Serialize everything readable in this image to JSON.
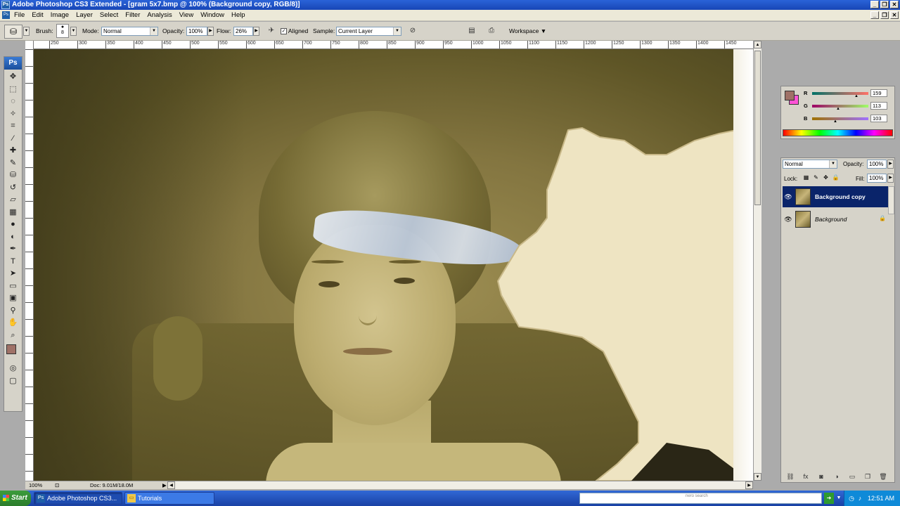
{
  "window": {
    "title": "Adobe Photoshop CS3 Extended - [gram 5x7.bmp @ 100% (Background copy, RGB/8)]"
  },
  "menu": {
    "items": [
      "File",
      "Edit",
      "Image",
      "Layer",
      "Select",
      "Filter",
      "Analysis",
      "View",
      "Window",
      "Help"
    ]
  },
  "options": {
    "brush_label": "Brush:",
    "brush_size": "8",
    "mode_label": "Mode:",
    "mode_value": "Normal",
    "opacity_label": "Opacity:",
    "opacity_value": "100%",
    "flow_label": "Flow:",
    "flow_value": "26%",
    "aligned_label": "Aligned",
    "sample_label": "Sample:",
    "sample_value": "Current Layer",
    "workspace_label": "Workspace ▼"
  },
  "toolbox": {
    "badge": "Ps",
    "tools": [
      "move-tool-icon",
      "marquee-tool-icon",
      "lasso-tool-icon",
      "magic-wand-icon",
      "crop-tool-icon",
      "eyedropper-icon",
      "healing-brush-icon",
      "brush-tool-icon",
      "clone-stamp-icon",
      "history-brush-icon",
      "eraser-icon",
      "gradient-tool-icon",
      "blur-tool-icon",
      "dodge-tool-icon",
      "pen-tool-icon",
      "type-tool-icon",
      "path-selection-icon",
      "shape-tool-icon",
      "notes-tool-icon",
      "eyedropper-2-icon",
      "hand-tool-icon",
      "zoom-tool-icon"
    ],
    "foreground_color": "#9f7167",
    "background_color": "#ff54d6"
  },
  "ruler": {
    "labels": [
      "250",
      "300",
      "350",
      "400",
      "450",
      "500",
      "550",
      "600",
      "650",
      "700",
      "750",
      "800",
      "850",
      "900",
      "950",
      "1000",
      "1050",
      "1100",
      "1150",
      "1200",
      "1250",
      "1300",
      "1350",
      "1400",
      "1450"
    ]
  },
  "status": {
    "zoom": "100%",
    "doc": "Doc: 9.01M/18.0M"
  },
  "color_panel": {
    "r_label": "R",
    "r_value": "159",
    "g_label": "G",
    "g_value": "113",
    "b_label": "B",
    "b_value": "103",
    "fg": "#9f7167",
    "bg": "#ff54d6"
  },
  "layers_panel": {
    "blend_mode": "Normal",
    "opacity_label": "Opacity:",
    "opacity_value": "100%",
    "lock_label": "Lock:",
    "fill_label": "Fill:",
    "fill_value": "100%",
    "layers": [
      {
        "name": "Background copy",
        "selected": true,
        "locked": false
      },
      {
        "name": "Background",
        "selected": false,
        "locked": true
      }
    ]
  },
  "taskbar": {
    "start": "Start",
    "items": [
      "Adobe Photoshop CS3...",
      "Tutorials"
    ],
    "search_brand": "nero search",
    "clock": "12:51 AM"
  }
}
